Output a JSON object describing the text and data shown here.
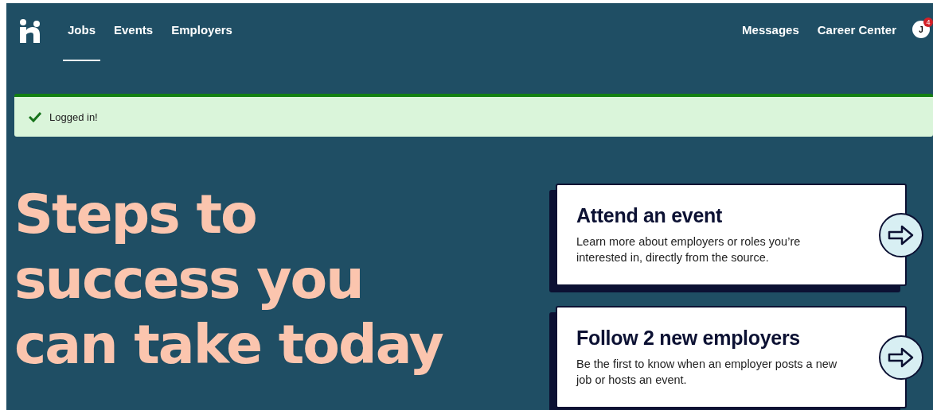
{
  "nav": {
    "links": [
      {
        "label": "Jobs",
        "selected": true
      },
      {
        "label": "Events",
        "selected": false
      },
      {
        "label": "Employers",
        "selected": false
      }
    ],
    "right_links": [
      "Messages",
      "Career Center"
    ],
    "avatar": {
      "initial": "J",
      "badge": "4"
    }
  },
  "alert": {
    "kind": "success",
    "message": "Logged in!"
  },
  "headline": [
    "Steps to",
    "success you",
    "can take today"
  ],
  "cards": [
    {
      "title": "Attend an event",
      "description": "Learn more about employers or roles you’re interested in, directly from the source."
    },
    {
      "title": "Follow 2 new employers",
      "description": "Be the first to know when an employer posts a new job or hosts an event."
    }
  ]
}
